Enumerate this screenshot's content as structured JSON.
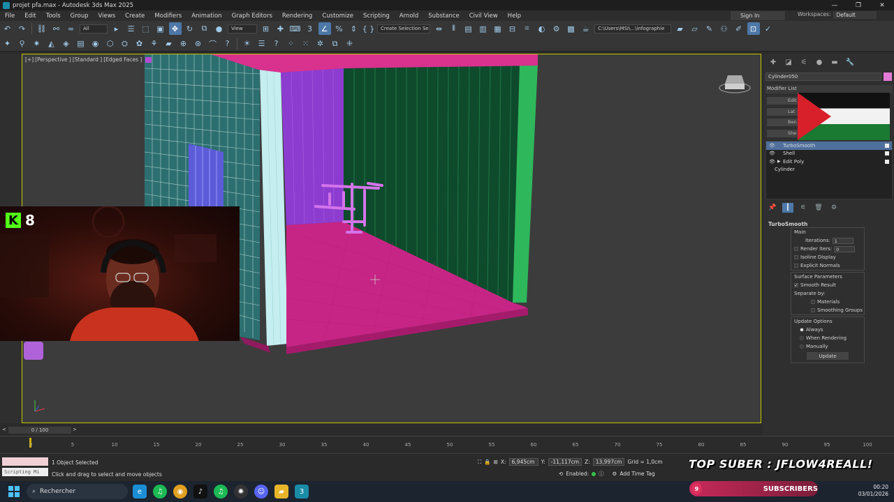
{
  "window": {
    "title": "projet pfa.max - Autodesk 3ds Max 2025",
    "controls": [
      "—",
      "❐",
      "✕"
    ]
  },
  "menu": {
    "items": [
      "File",
      "Edit",
      "Tools",
      "Group",
      "Views",
      "Create",
      "Modifiers",
      "Animation",
      "Graph Editors",
      "Rendering",
      "Customize",
      "Scripting",
      "Arnold",
      "Substance",
      "Civil View",
      "Help"
    ],
    "sign_in": "Sign In",
    "workspaces_label": "Workspaces:",
    "workspace_value": "Default"
  },
  "toolbar": {
    "filter_value": "All",
    "view_value": "View",
    "selection_set_placeholder": "Create Selection Se",
    "path_value": "C:\\Users\\MSI\\...\\infographie"
  },
  "viewport": {
    "labels": [
      "[+]",
      "[Perspective ]",
      "[Standard ]",
      "[Edged Faces ]"
    ],
    "webcam_counter": "8",
    "webcam_logo": "K"
  },
  "command_panel": {
    "object_name": "Cylinder050",
    "object_color": "#e27ad6",
    "modifier_list_label": "Modifier List",
    "modifier_buttons": [
      "Edit",
      "Lat",
      "Ben",
      "She"
    ],
    "stack": [
      {
        "label": "TurboSmooth",
        "selected": true,
        "eye": true,
        "arrow": false
      },
      {
        "label": "Shell",
        "selected": false,
        "eye": true,
        "arrow": false
      },
      {
        "label": "Edit Poly",
        "selected": false,
        "eye": true,
        "arrow": true
      },
      {
        "label": "Cylinder",
        "selected": false,
        "eye": false,
        "arrow": false
      }
    ],
    "turbosmooth": {
      "title": "TurboSmooth",
      "main": "Main",
      "iterations_label": "Iterations:",
      "iterations_value": "1",
      "render_iters_label": "Render Iters:",
      "render_iters_value": "0",
      "isoline_display": "Isoline Display",
      "explicit_normals": "Explicit Normals",
      "surface_parameters": "Surface Parameters",
      "smooth_result": "Smooth Result",
      "separate_by": "Separate by:",
      "materials": "Materials",
      "smoothing_groups": "Smoothing Groups",
      "update_options": "Update Options",
      "always": "Always",
      "when_rendering": "When Rendering",
      "manually": "Manually",
      "update_button": "Update"
    }
  },
  "timeline": {
    "frame_display": "0 / 100",
    "ticks": [
      "0",
      "5",
      "10",
      "15",
      "20",
      "25",
      "30",
      "35",
      "40",
      "45",
      "50",
      "55",
      "60",
      "65",
      "70",
      "75",
      "80",
      "85",
      "90",
      "95",
      "100"
    ]
  },
  "status": {
    "script_label": "Scripting Mi",
    "selection": "1 Object Selected",
    "hint": "Click and drag to select and move objects",
    "x_label": "X:",
    "x_value": "6,945cm",
    "y_label": "Y:",
    "y_value": "-11,117cm",
    "z_label": "Z:",
    "z_value": "13,997cm",
    "grid": "Grid = 1,0cm",
    "enabled": "Enabled:",
    "add_time_tag": "Add Time Tag"
  },
  "overlay": {
    "top_suber": "TOP SUBER : JFLOW4REALL!",
    "subs_count": "9",
    "subs_label": "SUBSCRIBERS"
  },
  "taskbar": {
    "search_placeholder": "Rechercher",
    "time": "00:20",
    "date": "03/01/2026"
  }
}
